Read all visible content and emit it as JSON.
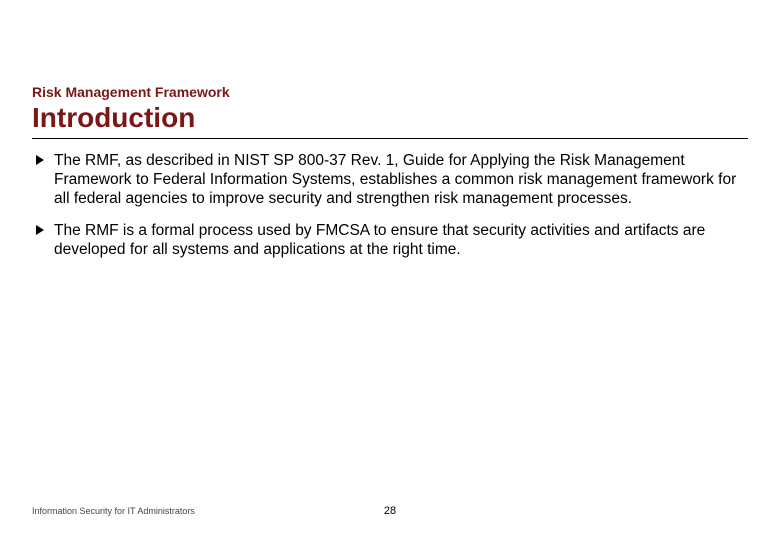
{
  "header": {
    "suptitle": "Risk Management Framework",
    "title": "Introduction"
  },
  "bullets": [
    "The RMF, as described in NIST SP 800-37 Rev. 1, Guide for Applying the Risk Management Framework to Federal Information Systems, establishes a common risk management framework for all federal agencies to improve security and strengthen risk management processes.",
    "The RMF is a formal process used by FMCSA to ensure that security activities and artifacts are developed for all systems and applications at the right time."
  ],
  "footer": {
    "text": "Information Security for IT Administrators",
    "page": "28"
  }
}
